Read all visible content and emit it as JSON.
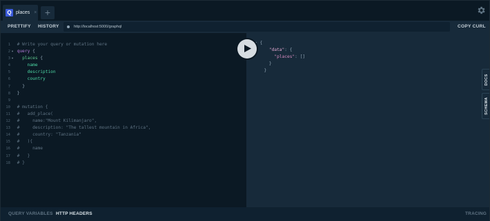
{
  "tabs": {
    "items": [
      {
        "badge": "Q",
        "label": "places",
        "close": "×"
      }
    ],
    "add": "+"
  },
  "toolbar": {
    "prettify": "PRETTIFY",
    "history": "HISTORY",
    "endpoint": "http://localhost:5000/graphql",
    "copy_curl": "COPY CURL"
  },
  "editor": {
    "lines": [
      "1",
      "2",
      "3",
      "4",
      "5",
      "6",
      "7",
      "8",
      "9",
      "10",
      "11",
      "12",
      "13",
      "14",
      "15",
      "16",
      "17",
      "18"
    ],
    "text": {
      "l1": "# Write your query or mutation here",
      "l2_kw": "query",
      "l2_p": " {",
      "l3_def": "places",
      "l3_p": " {",
      "l4": "name",
      "l5": "description",
      "l6": "country",
      "l7": "}",
      "l8": "}",
      "l10": "# mutation {",
      "l11": "#   add_place(",
      "l12": "#     name:\"Mount Kilimanjaro\",",
      "l13": "#     description: \"The tallest mountain in Africa\",",
      "l14": "#     country: \"Tanzania\"",
      "l15": "#   ){",
      "l16": "#     name",
      "l17": "#   }",
      "l18": "# }"
    }
  },
  "result": {
    "open": "{",
    "data_key": "\"data\"",
    "colon_open": ": {",
    "places_key": "\"places\"",
    "places_val": ": []",
    "close_inner": "}",
    "close_outer": "}"
  },
  "side_tabs": {
    "docs": "DOCS",
    "schema": "SCHEMA"
  },
  "bottom": {
    "query_variables": "QUERY VARIABLES",
    "http_headers": "HTTP HEADERS",
    "tracing": "TRACING"
  },
  "colors": {
    "background": "#0b1924",
    "panel": "#172a3a",
    "keyword": "#b179d6",
    "field": "#4cd7a4",
    "json_key": "#e2a8d0"
  }
}
